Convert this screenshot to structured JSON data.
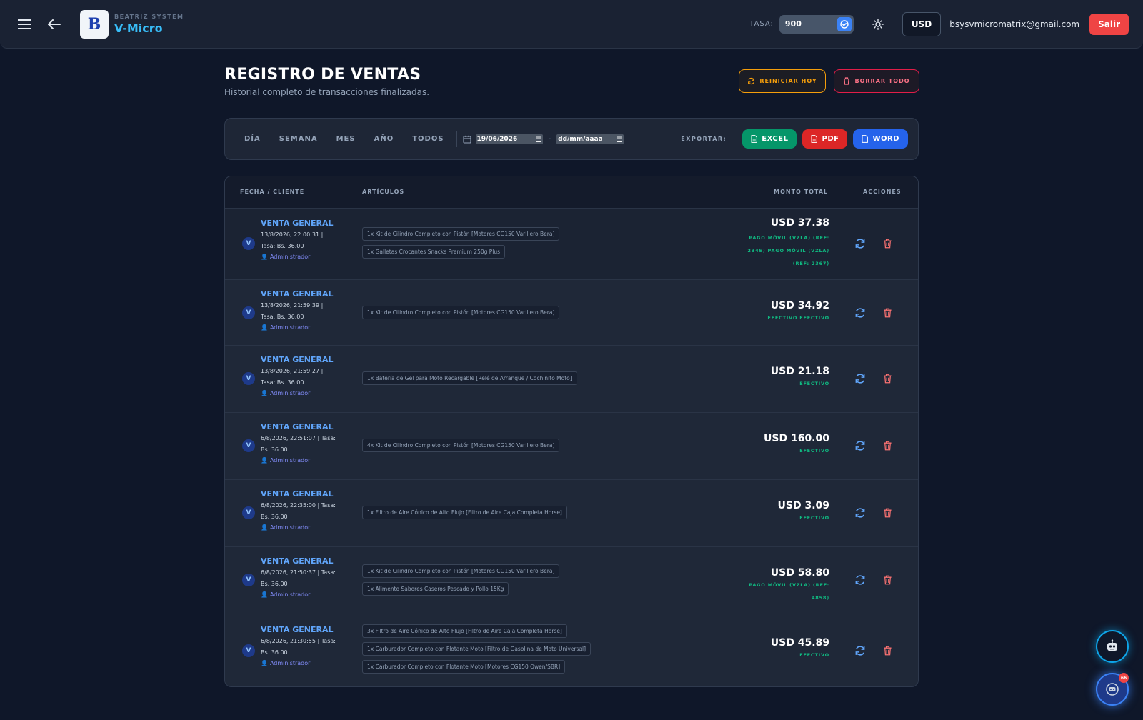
{
  "topbar": {
    "brand_sub": "BEATRIZ SYSTEM",
    "brand_main": "V-Micro",
    "tasa_label": "TASA:",
    "tasa_value": "900",
    "currency": "USD",
    "email": "bsysvmicromatrix@gmail.com",
    "logout": "Salir"
  },
  "header": {
    "title": "REGISTRO DE VENTAS",
    "subtitle": "Historial completo de transacciones finalizadas.",
    "reset_today": "REINICIAR HOY",
    "delete_all": "BORRAR TODO"
  },
  "filters": {
    "tabs": [
      "DÍA",
      "SEMANA",
      "MES",
      "AÑO",
      "TODOS"
    ],
    "date_from": "19/06/2026",
    "date_to": "dd/mm/aaaa",
    "export_label": "EXPORTAR:",
    "excel": "EXCEL",
    "pdf": "PDF",
    "word": "WORD"
  },
  "table": {
    "headers": {
      "client": "FECHA / CLIENTE",
      "items": "ARTÍCULOS",
      "amount": "MONTO TOTAL",
      "actions": "ACCIONES"
    },
    "rows": [
      {
        "initial": "V",
        "client": "VENTA GENERAL",
        "meta1": "13/8/2026, 22:00:31 |",
        "meta2": "Tasa: Bs. 36.00",
        "user": "Administrador",
        "items": [
          "1x Kit de Cilindro Completo con Pistón [Motores CG150 Varillero Bera]",
          "1x Galletas Crocantes Snacks Premium 250g Plus"
        ],
        "amount": "USD 37.38",
        "payment": "PAGO MÓVIL (VZLA) (REF: 2345) PAGO MÓVIL (VZLA) (REF: 2367)"
      },
      {
        "initial": "V",
        "client": "VENTA GENERAL",
        "meta1": "13/8/2026, 21:59:39 |",
        "meta2": "Tasa: Bs. 36.00",
        "user": "Administrador",
        "items": [
          "1x Kit de Cilindro Completo con Pistón [Motores CG150 Varillero Bera]"
        ],
        "amount": "USD 34.92",
        "payment": "EFECTIVO  EFECTIVO"
      },
      {
        "initial": "V",
        "client": "VENTA GENERAL",
        "meta1": "13/8/2026, 21:59:27 |",
        "meta2": "Tasa: Bs. 36.00",
        "user": "Administrador",
        "items": [
          "1x Batería de Gel para Moto Recargable [Relé de Arranque / Cochinito Moto]"
        ],
        "amount": "USD 21.18",
        "payment": "EFECTIVO"
      },
      {
        "initial": "V",
        "client": "VENTA GENERAL",
        "meta1": "6/8/2026, 22:51:07 | Tasa:",
        "meta2": "Bs. 36.00",
        "user": "Administrador",
        "items": [
          "4x Kit de Cilindro Completo con Pistón [Motores CG150 Varillero Bera]"
        ],
        "amount": "USD 160.00",
        "payment": "EFECTIVO"
      },
      {
        "initial": "V",
        "client": "VENTA GENERAL",
        "meta1": "6/8/2026, 22:35:00 | Tasa:",
        "meta2": "Bs. 36.00",
        "user": "Administrador",
        "items": [
          "1x Filtro de Aire Cónico de Alto Flujo [Filtro de Aire Caja Completa Horse]"
        ],
        "amount": "USD 3.09",
        "payment": "EFECTIVO"
      },
      {
        "initial": "V",
        "client": "VENTA GENERAL",
        "meta1": "6/8/2026, 21:50:37 | Tasa:",
        "meta2": "Bs. 36.00",
        "user": "Administrador",
        "items": [
          "1x Kit de Cilindro Completo con Pistón [Motores CG150 Varillero Bera]",
          "1x Alimento Sabores Caseros Pescado y Pollo 15Kg"
        ],
        "amount": "USD 58.80",
        "payment": "PAGO MÓVIL (VZLA) (REF: 4858)"
      },
      {
        "initial": "V",
        "client": "VENTA GENERAL",
        "meta1": "6/8/2026, 21:30:55 | Tasa:",
        "meta2": "Bs. 36.00",
        "user": "Administrador",
        "items": [
          "3x Filtro de Aire Cónico de Alto Flujo [Filtro de Aire Caja Completa Horse]",
          "1x Carburador Completo con Flotante Moto [Filtro de Gasolina de Moto Universal]",
          "1x Carburador Completo con Flotante Moto [Motores CG150 Owen/SBR]"
        ],
        "amount": "USD 45.89",
        "payment": "EFECTIVO"
      }
    ]
  },
  "fab_badge": "66",
  "colors": {
    "accent": "#3b82f6",
    "success": "#10b981",
    "danger": "#ef4444",
    "warning": "#f59e0b"
  }
}
